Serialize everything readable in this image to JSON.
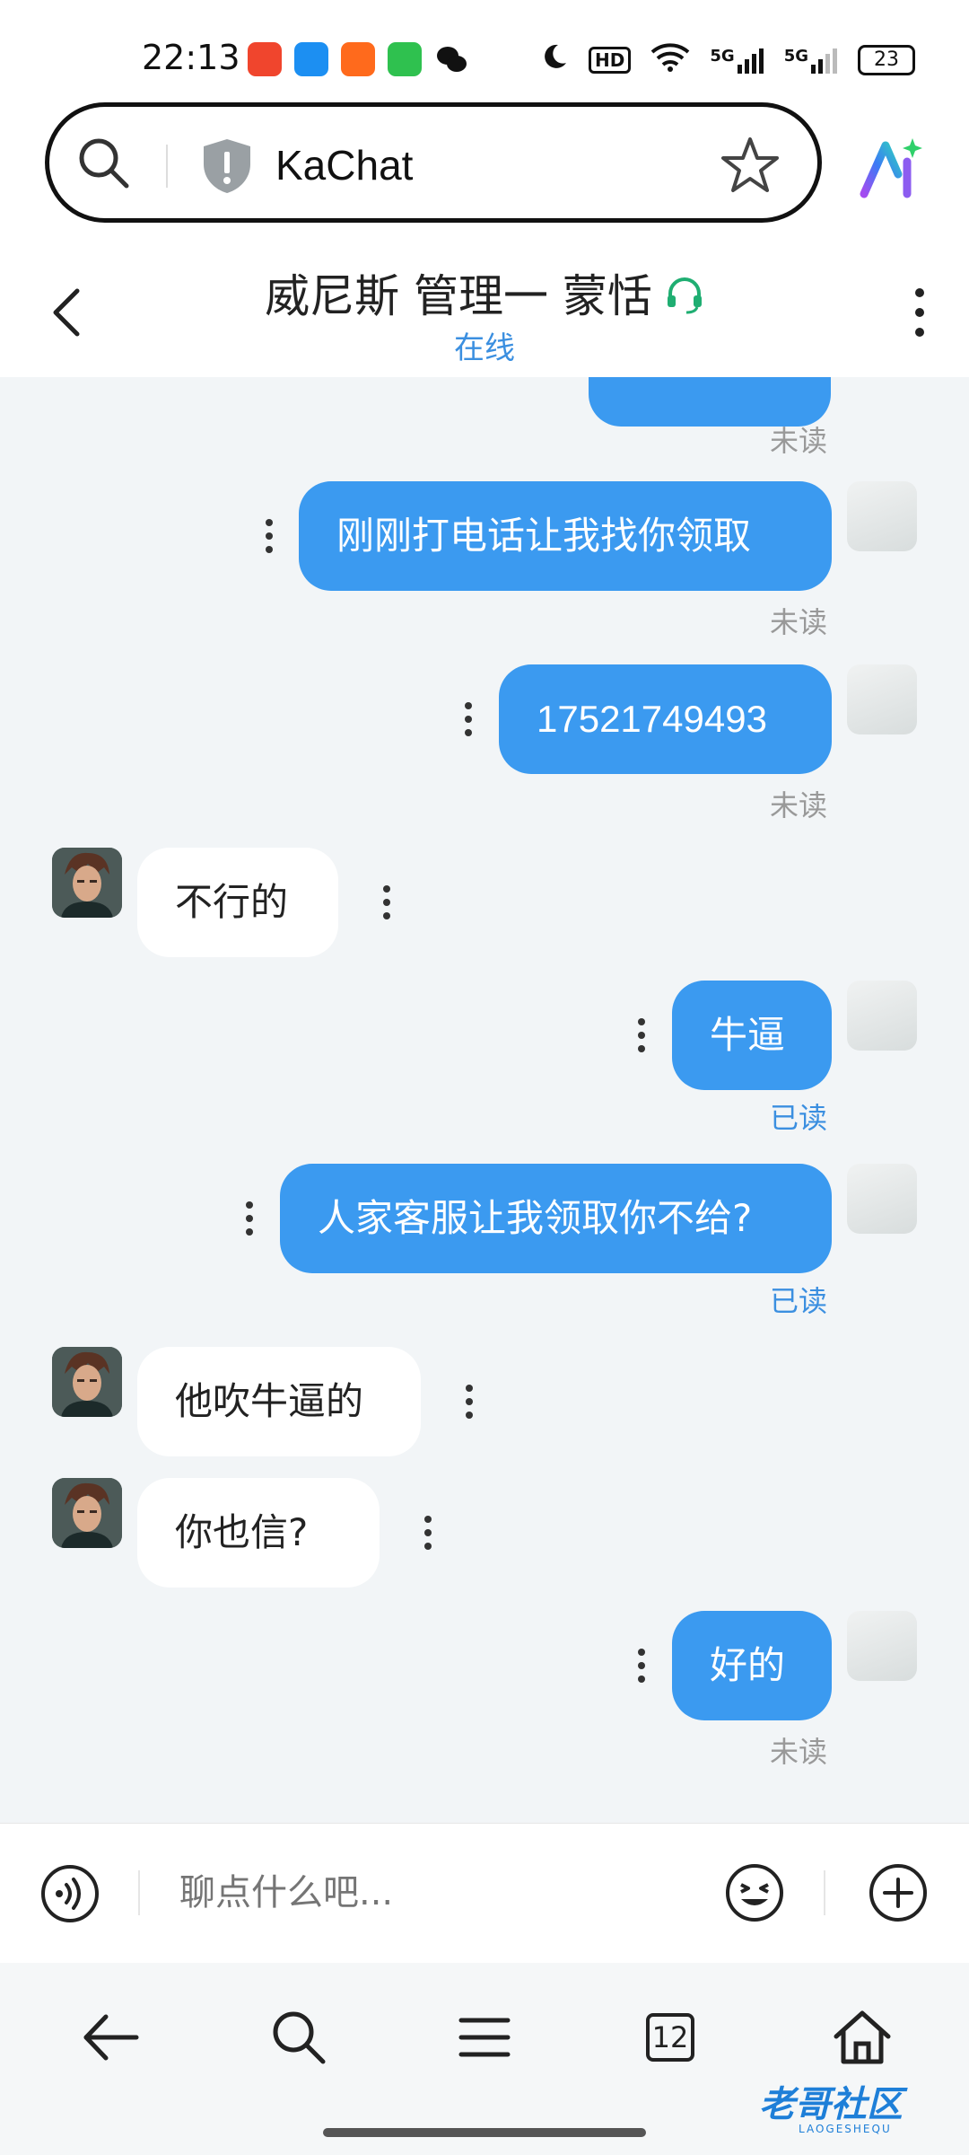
{
  "status_bar": {
    "time": "22:13",
    "battery": "23",
    "network_1": "5G",
    "network_2": "5G",
    "hd_label": "HD"
  },
  "browser": {
    "url": "KaChat",
    "tab_count": "12"
  },
  "chat": {
    "title": "威尼斯 管理一 蒙恬",
    "presence": "在线",
    "messages": [
      {
        "dir": "out",
        "text": "",
        "status": "未读"
      },
      {
        "dir": "out",
        "text": "刚刚打电话让我找你领取",
        "status": "未读"
      },
      {
        "dir": "out",
        "text": "17521749493",
        "status": "未读"
      },
      {
        "dir": "in",
        "text": "不行的"
      },
      {
        "dir": "out",
        "text": "牛逼",
        "status": "已读"
      },
      {
        "dir": "out",
        "text": "人家客服让我领取你不给?",
        "status": "已读"
      },
      {
        "dir": "in",
        "text": "他吹牛逼的"
      },
      {
        "dir": "in",
        "text": "你也信?"
      },
      {
        "dir": "out",
        "text": "好的",
        "status": "未读"
      }
    ]
  },
  "input": {
    "placeholder": "聊点什么吧..."
  },
  "watermark": {
    "text": "老哥社区",
    "sub": "LAOGESHEQU"
  },
  "colors": {
    "outgoing_bubble": "#3b9af0",
    "incoming_bubble": "#ffffff",
    "chat_background": "#f2f5f7",
    "presence": "#3b8fe0",
    "headset": "#1fae72"
  }
}
